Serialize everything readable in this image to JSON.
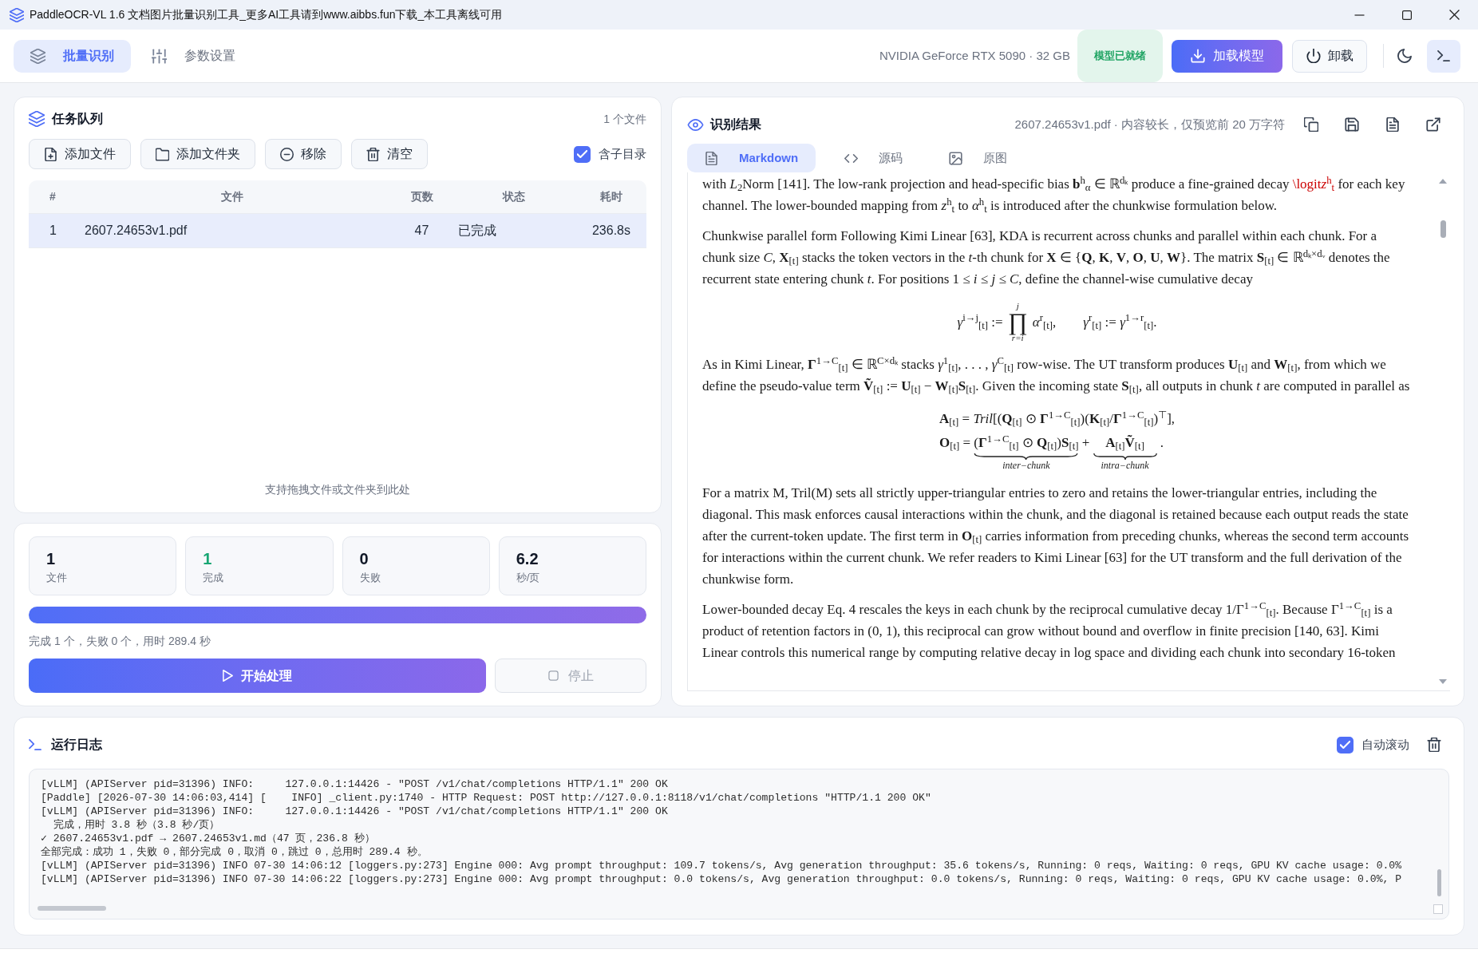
{
  "window": {
    "title": "PaddleOCR-VL 1.6 文档图片批量识别工具_更多AI工具请到www.aibbs.fun下载_本工具离线可用"
  },
  "header": {
    "nav_tabs": [
      {
        "label": "批量识别",
        "selected": true
      },
      {
        "label": "参数设置",
        "selected": false
      }
    ],
    "gpu": "NVIDIA GeForce RTX 5090 · 32 GB",
    "model_status": "模型已就绪",
    "load_button": "加载模型",
    "unload_button": "卸载"
  },
  "task_queue": {
    "title": "任务队列",
    "file_count": "1 个文件",
    "buttons": [
      "添加文件",
      "添加文件夹",
      "移除",
      "清空"
    ],
    "include_subdirs": {
      "label": "含子目录",
      "checked": true
    },
    "table": {
      "columns": [
        "#",
        "文件",
        "页数",
        "状态",
        "耗时"
      ],
      "rows": [
        {
          "cells": [
            "1",
            "2607.24653v1.pdf",
            "47",
            "已完成",
            "236.8s"
          ],
          "selected": true
        }
      ]
    },
    "drop_hint": "支持拖拽文件或文件夹到此处"
  },
  "stats": {
    "cards": [
      {
        "value": "1",
        "label": "文件",
        "color": "#111827"
      },
      {
        "value": "1",
        "label": "完成",
        "color": "#17a673"
      },
      {
        "value": "0",
        "label": "失败",
        "color": "#111827"
      },
      {
        "value": "6.2",
        "label": "秒/页",
        "color": "#111827"
      }
    ],
    "progress": {
      "level": 1
    },
    "summary": "完成 1 个，失败 0 个，用时 289.4 秒",
    "start_button": {
      "label": "开始处理"
    },
    "stop_button": {
      "label": "停止",
      "disabled": true
    }
  },
  "result": {
    "title": "识别结果",
    "info": "2607.24653v1.pdf · 内容较长，仅预览前 20 万字符",
    "tabs": [
      {
        "label": "Markdown",
        "selected": true
      },
      {
        "label": "源码",
        "selected": false
      },
      {
        "label": "原图",
        "selected": false
      }
    ],
    "blocks": [
      {
        "kind": "paragraph",
        "runs": [
          {
            "kind": "text",
            "text": "with *L*$_{2}$Norm [141]. The low-rank projection and head-specific bias **b**$^{h}$$_{α}$ ∈ ℝ$^{dₖ}$ produce a fine-grained decay "
          },
          {
            "kind": "error",
            "text": "\\logit"
          },
          {
            "kind": "error",
            "text": "*z*$^{h}$$_{t}$"
          },
          {
            "kind": "text",
            "text": " for each key channel. The lower-bounded mapping from *z*$^{h}$$_{t}$ to *α*$^{h}$$_{t}$ is introduced after the chunkwise formulation below."
          }
        ]
      },
      {
        "kind": "paragraph",
        "runs": [
          {
            "kind": "text",
            "text": "Chunkwise parallel form Following Kimi Linear [63], KDA is recurrent across chunks and parallel within each chunk. For a chunk size *C*, **X**$_{[t]}$ stacks the token vectors in the *t*-th chunk for **X** ∈ {**Q**, **K**, **V**, **O**, **U**, **W**}. The matrix **S**$_{[t]}$ ∈ ℝ$^{dₖ×dᵥ}$ denotes the recurrent state entering chunk *t*. For positions 1 ≤ *i* ≤ *j* ≤ *C*, define the channel-wise cumulative decay"
          }
        ]
      },
      {
        "kind": "equation",
        "lines": [
          [
            {
              "kind": "text",
              "text": "*γ*$^{i→j}$$_{[t]}$ := "
            },
            {
              "kind": "bigop",
              "symbol": "∏",
              "upper": "j",
              "lower": "r=i"
            },
            {
              "kind": "text",
              "text": " *α*$^{r}$$_{[t]}$,        *γ*$^{r}$$_{[t]}$ := *γ*$^{1→r}$$_{[t]}$."
            }
          ]
        ]
      },
      {
        "kind": "paragraph",
        "runs": [
          {
            "kind": "text",
            "text": "As in Kimi Linear, **Γ**$^{1→C}$$_{[t]}$ ∈ ℝ$^{C×dₖ}$ stacks *γ*$^{1}$$_{[t]}$, . . . , *γ*$^{C}$$_{[t]}$ row-wise. The UT transform produces **U**$_{[t]}$ and **W**$_{[t]}$, from which we define the pseudo-value term **Ṽ**$_{[t]}$ := **U**$_{[t]}$ − **W**$_{[t]}$**S**$_{[t]}$. Given the incoming state **S**$_{[t]}$, all outputs in chunk *t* are computed in parallel as"
          }
        ]
      },
      {
        "kind": "equation",
        "lines": [
          [
            {
              "kind": "text",
              "text": "**A**$_{[t]}$ = *Tril*[(**Q**$_{[t]}$ ⊙ **Γ**$^{1→C}$$_{[t]}$)(**K**$_{[t]}$/**Γ**$^{1→C}$$_{[t]}$)$^{⊤}$],"
            }
          ],
          [
            {
              "kind": "text",
              "text": "**O**$_{[t]}$ = "
            },
            {
              "kind": "underbrace",
              "text": "(**Γ**$^{1→C}$$_{[t]}$ ⊙ **Q**$_{[t]}$)**S**$_{[t]}$",
              "label": "inter−chunk"
            },
            {
              "kind": "text",
              "text": " + "
            },
            {
              "kind": "underbrace",
              "text": "**A**$_{[t]}$**Ṽ**$_{[t]}$",
              "label": "intra−chunk"
            },
            {
              "kind": "text",
              "text": " ."
            }
          ]
        ]
      },
      {
        "kind": "paragraph",
        "runs": [
          {
            "kind": "text",
            "text": "For a matrix M, Tril(M) sets all strictly upper-triangular entries to zero and retains the lower-triangular entries, including the diagonal. This mask enforces causal interactions within the chunk, and the diagonal is retained because each output reads the state after the current-token update. The first term in **O**$_{[t]}$ carries information from preceding chunks, whereas the second term accounts for interactions within the current chunk. We refer readers to Kimi Linear [63] for the UT transform and the full derivation of the chunkwise form."
          }
        ]
      },
      {
        "kind": "paragraph",
        "runs": [
          {
            "kind": "text",
            "text": "Lower-bounded decay Eq. 4 rescales the keys in each chunk by the reciprocal cumulative decay 1/Γ$^{1→C}$$_{[t]}$. Because Γ$^{1→C}$$_{[t]}$ is a product of retention factors in (0, 1), this reciprocal can grow without bound and overflow in finite precision [140, 63]. Kimi Linear controls this numerical range by computing relative decay in log space and dividing each chunk into secondary 16-token"
          }
        ]
      }
    ]
  },
  "log": {
    "title": "运行日志",
    "auto_scroll": {
      "label": "自动滚动",
      "checked": true
    },
    "lines": [
      "[vLLM] (APIServer pid=31396) INFO:     127.0.0.1:14426 - \"POST /v1/chat/completions HTTP/1.1\" 200 OK",
      "[Paddle] [2026-07-30 14:06:03,414] [    INFO] _client.py:1740 - HTTP Request: POST http://127.0.0.1:8118/v1/chat/completions \"HTTP/1.1 200 OK\"",
      "[vLLM] (APIServer pid=31396) INFO:     127.0.0.1:14426 - \"POST /v1/chat/completions HTTP/1.1\" 200 OK",
      "  完成，用时 3.8 秒（3.8 秒/页）",
      "✓ 2607.24653v1.pdf → 2607.24653v1.md（47 页，236.8 秒）",
      "全部完成：成功 1，失败 0，部分完成 0，取消 0，跳过 0，总用时 289.4 秒。",
      "[vLLM] (APIServer pid=31396) INFO 07-30 14:06:12 [loggers.py:273] Engine 000: Avg prompt throughput: 109.7 tokens/s, Avg generation throughput: 35.6 tokens/s, Running: 0 reqs, Waiting: 0 reqs, GPU KV cache usage: 0.0%",
      "[vLLM] (APIServer pid=31396) INFO 07-30 14:06:22 [loggers.py:273] Engine 000: Avg prompt throughput: 0.0 tokens/s, Avg generation throughput: 0.0 tokens/s, Running: 0 reqs, Waiting: 0 reqs, GPU KV cache usage: 0.0%, P"
    ]
  }
}
